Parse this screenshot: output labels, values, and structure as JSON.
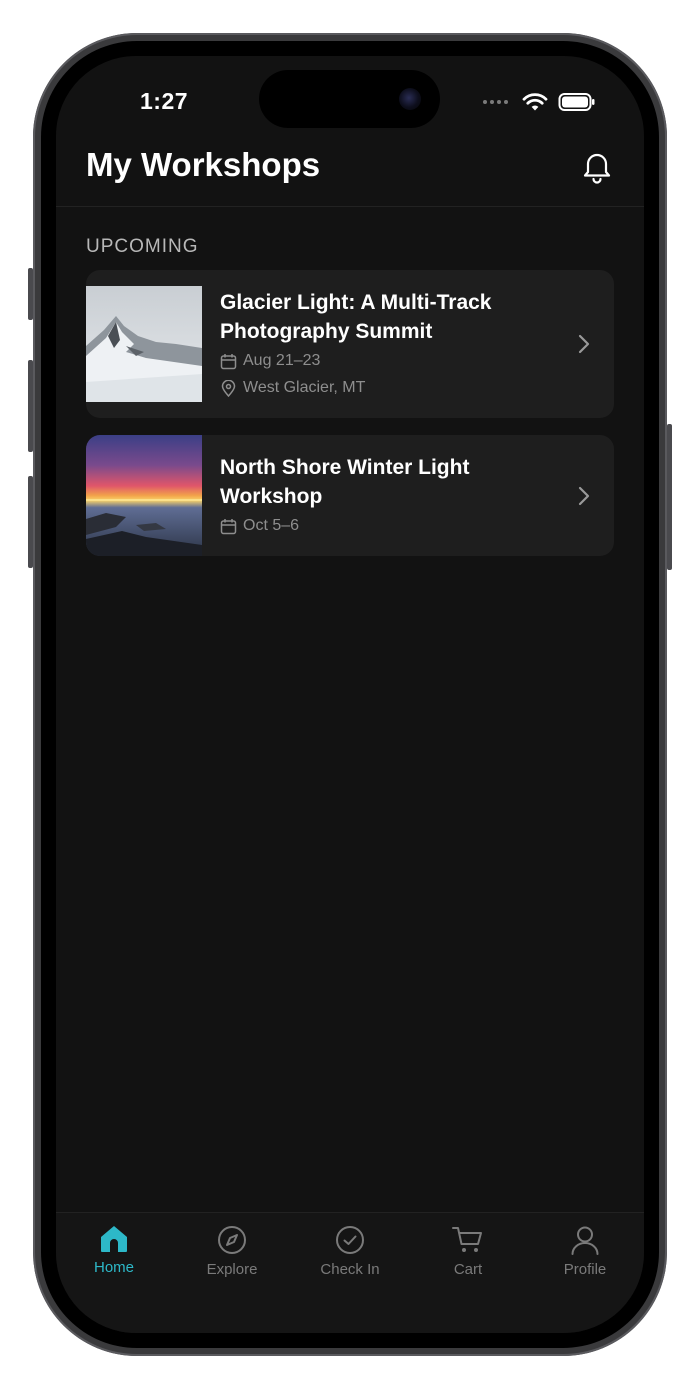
{
  "status_bar": {
    "time": "1:27"
  },
  "header": {
    "title": "My Workshops"
  },
  "sections": [
    {
      "label": "UPCOMING",
      "items": [
        {
          "title": "Glacier Light: A Multi-Track Photography Summit",
          "dates": "Aug 21–23",
          "location": "West Glacier, MT"
        },
        {
          "title": "North Shore Winter Light Workshop",
          "dates": "Oct 5–6"
        }
      ]
    }
  ],
  "tabbar": {
    "tabs": [
      {
        "label": "Home",
        "icon": "home-icon",
        "active": true
      },
      {
        "label": "Explore",
        "icon": "compass-icon",
        "active": false
      },
      {
        "label": "Check In",
        "icon": "check-circle-icon",
        "active": false
      },
      {
        "label": "Cart",
        "icon": "cart-icon",
        "active": false
      },
      {
        "label": "Profile",
        "icon": "user-icon",
        "active": false
      }
    ]
  },
  "colors": {
    "accent": "#2db8c8",
    "background": "#121212",
    "card": "#1e1e1e",
    "muted_text": "#8e8e8e"
  }
}
